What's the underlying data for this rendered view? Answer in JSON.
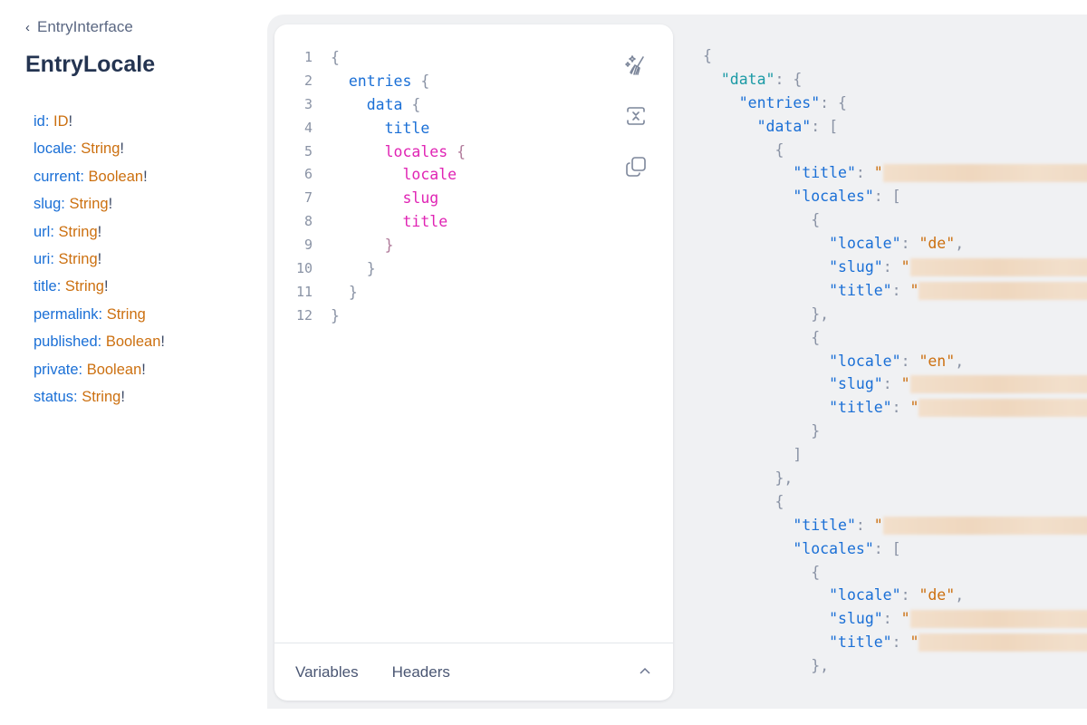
{
  "docs": {
    "back_label": "EntryInterface",
    "title": "EntryLocale",
    "fields": [
      {
        "name": "id",
        "type": "ID",
        "non_null": "!"
      },
      {
        "name": "locale",
        "type": "String",
        "non_null": "!"
      },
      {
        "name": "current",
        "type": "Boolean",
        "non_null": "!"
      },
      {
        "name": "slug",
        "type": "String",
        "non_null": "!"
      },
      {
        "name": "url",
        "type": "String",
        "non_null": "!"
      },
      {
        "name": "uri",
        "type": "String",
        "non_null": "!"
      },
      {
        "name": "title",
        "type": "String",
        "non_null": "!"
      },
      {
        "name": "permalink",
        "type": "String",
        "non_null": ""
      },
      {
        "name": "published",
        "type": "Boolean",
        "non_null": "!"
      },
      {
        "name": "private",
        "type": "Boolean",
        "non_null": "!"
      },
      {
        "name": "status",
        "type": "String",
        "non_null": "!"
      }
    ]
  },
  "editor": {
    "lines": [
      {
        "n": "1",
        "indent": "",
        "text": "",
        "close": "{"
      },
      {
        "n": "2",
        "indent": "  ",
        "text": "entries",
        "close": " {"
      },
      {
        "n": "3",
        "indent": "    ",
        "text": "data",
        "close": " {"
      },
      {
        "n": "4",
        "indent": "      ",
        "text": "title",
        "close": ""
      },
      {
        "n": "5",
        "indent": "      ",
        "text": "locales",
        "close": " {"
      },
      {
        "n": "6",
        "indent": "        ",
        "text": "locale",
        "close": ""
      },
      {
        "n": "7",
        "indent": "        ",
        "text": "slug",
        "close": ""
      },
      {
        "n": "8",
        "indent": "        ",
        "text": "title",
        "close": ""
      },
      {
        "n": "9",
        "indent": "      ",
        "text": "",
        "close": "}"
      },
      {
        "n": "10",
        "indent": "    ",
        "text": "",
        "close": "}"
      },
      {
        "n": "11",
        "indent": "  ",
        "text": "",
        "close": "}"
      },
      {
        "n": "12",
        "indent": "",
        "text": "",
        "close": "}"
      }
    ],
    "tools": [
      {
        "icon": "prettify-icon",
        "label": "Prettify query"
      },
      {
        "icon": "merge-fragments-icon",
        "label": "Merge fragments"
      },
      {
        "icon": "copy-icon",
        "label": "Copy query"
      }
    ],
    "footer_tabs": [
      "Variables",
      "Headers"
    ],
    "footer_toggle_icon": "chevron-up-icon"
  },
  "result": {
    "lines": [
      {
        "indent": "",
        "key": "",
        "value": "",
        "punct": "{",
        "kind": "punct"
      },
      {
        "indent": "  ",
        "key": "\"data\"",
        "value": "",
        "punct": ": {",
        "kind": "root"
      },
      {
        "indent": "    ",
        "key": "\"entries\"",
        "value": "",
        "punct": ": {",
        "kind": "key"
      },
      {
        "indent": "      ",
        "key": "\"data\"",
        "value": "",
        "punct": ": [",
        "kind": "key"
      },
      {
        "indent": "        ",
        "key": "",
        "value": "",
        "punct": "{",
        "kind": "punct"
      },
      {
        "indent": "          ",
        "key": "\"title\"",
        "value": "\"",
        "punct": ": ",
        "kind": "redacted"
      },
      {
        "indent": "          ",
        "key": "\"locales\"",
        "value": "",
        "punct": ": [",
        "kind": "key"
      },
      {
        "indent": "            ",
        "key": "",
        "value": "",
        "punct": "{",
        "kind": "punct"
      },
      {
        "indent": "              ",
        "key": "\"locale\"",
        "value": "\"de\"",
        "punct": ": ",
        "kind": "string",
        "trail": ","
      },
      {
        "indent": "              ",
        "key": "\"slug\"",
        "value": "\"",
        "punct": ": ",
        "kind": "redacted"
      },
      {
        "indent": "              ",
        "key": "\"title\"",
        "value": "\"",
        "punct": ": ",
        "kind": "redacted"
      },
      {
        "indent": "            ",
        "key": "",
        "value": "",
        "punct": "},",
        "kind": "punct"
      },
      {
        "indent": "            ",
        "key": "",
        "value": "",
        "punct": "{",
        "kind": "punct"
      },
      {
        "indent": "              ",
        "key": "\"locale\"",
        "value": "\"en\"",
        "punct": ": ",
        "kind": "string",
        "trail": ","
      },
      {
        "indent": "              ",
        "key": "\"slug\"",
        "value": "\"",
        "punct": ": ",
        "kind": "redacted"
      },
      {
        "indent": "              ",
        "key": "\"title\"",
        "value": "\"",
        "punct": ": ",
        "kind": "redacted"
      },
      {
        "indent": "            ",
        "key": "",
        "value": "",
        "punct": "}",
        "kind": "punct"
      },
      {
        "indent": "          ",
        "key": "",
        "value": "",
        "punct": "]",
        "kind": "punct"
      },
      {
        "indent": "        ",
        "key": "",
        "value": "",
        "punct": "},",
        "kind": "punct"
      },
      {
        "indent": "        ",
        "key": "",
        "value": "",
        "punct": "{",
        "kind": "punct"
      },
      {
        "indent": "          ",
        "key": "\"title\"",
        "value": "\"",
        "punct": ": ",
        "kind": "redacted"
      },
      {
        "indent": "          ",
        "key": "\"locales\"",
        "value": "",
        "punct": ": [",
        "kind": "key"
      },
      {
        "indent": "            ",
        "key": "",
        "value": "",
        "punct": "{",
        "kind": "punct"
      },
      {
        "indent": "              ",
        "key": "\"locale\"",
        "value": "\"de\"",
        "punct": ": ",
        "kind": "string",
        "trail": ","
      },
      {
        "indent": "              ",
        "key": "\"slug\"",
        "value": "\"",
        "punct": ": ",
        "kind": "redacted"
      },
      {
        "indent": "              ",
        "key": "\"title\"",
        "value": "\"",
        "punct": ": ",
        "kind": "redacted"
      },
      {
        "indent": "            ",
        "key": "",
        "value": "",
        "punct": "},",
        "kind": "punct"
      }
    ]
  },
  "colors": {
    "field": "#1a6fd6",
    "type": "#cc7010",
    "nested_field": "#e024b4",
    "root_key": "#1a9aa5",
    "workspace_bg": "#f0f1f3"
  }
}
